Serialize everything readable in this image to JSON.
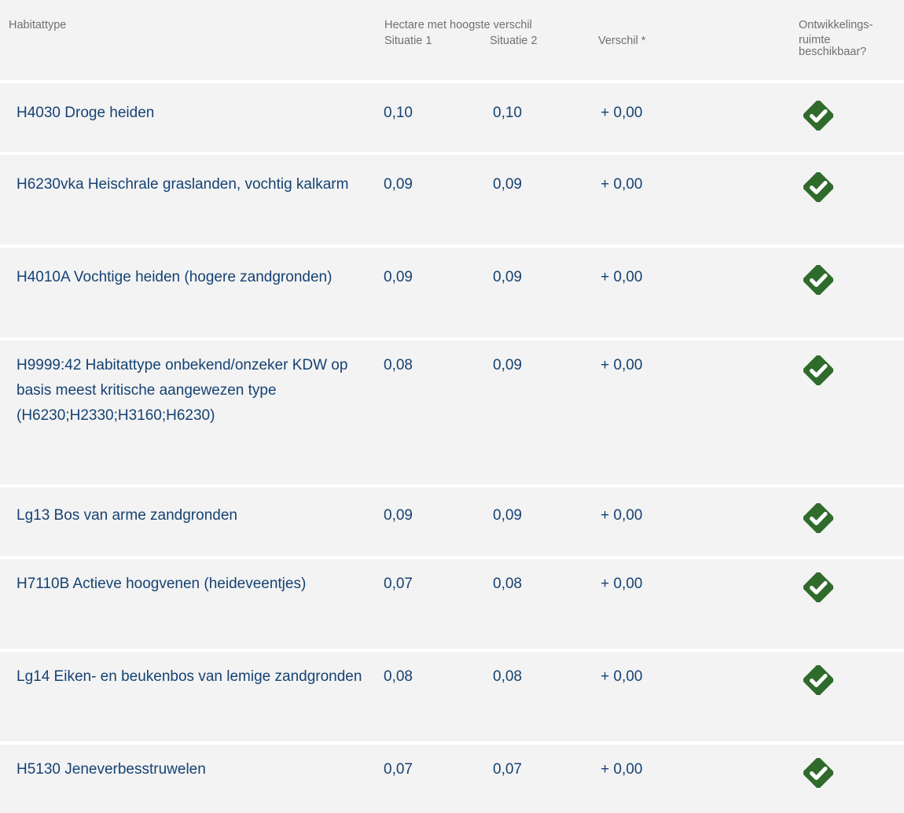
{
  "header": {
    "habitat_label": "Habitattype",
    "hectare_label": "Hectare met hoogste verschil",
    "situatie1_label": "Situatie 1",
    "situatie2_label": "Situatie 2",
    "verschil_label": "Verschil *",
    "ontwikkel_line1": "Ontwikkelings-",
    "ontwikkel_line2": "ruimte",
    "ontwikkel_line3": "beschikbaar?"
  },
  "rows": [
    {
      "name": "H4030 Droge heiden",
      "situatie1": "0,10",
      "situatie2": "0,10",
      "verschil": "+ 0,00",
      "available": true
    },
    {
      "name": "H6230vka Heischrale graslanden, vochtig kalkarm",
      "situatie1": "0,09",
      "situatie2": "0,09",
      "verschil": "+ 0,00",
      "available": true
    },
    {
      "name": "H4010A Vochtige heiden (hogere zandgronden)",
      "situatie1": "0,09",
      "situatie2": "0,09",
      "verschil": "+ 0,00",
      "available": true
    },
    {
      "name": "H9999:42 Habitattype onbekend/onzeker KDW op basis meest kritische aangewezen type (H6230;H2330;H3160;H6230)",
      "situatie1": "0,08",
      "situatie2": "0,09",
      "verschil": "+ 0,00",
      "available": true
    },
    {
      "name": "Lg13 Bos van arme zandgronden",
      "situatie1": "0,09",
      "situatie2": "0,09",
      "verschil": "+ 0,00",
      "available": true
    },
    {
      "name": "H7110B Actieve hoogvenen (heideveentjes)",
      "situatie1": "0,07",
      "situatie2": "0,08",
      "verschil": "+ 0,00",
      "available": true
    },
    {
      "name": "Lg14 Eiken- en beukenbos van lemige zandgronden",
      "situatie1": "0,08",
      "situatie2": "0,08",
      "verschil": "+ 0,00",
      "available": true
    },
    {
      "name": "H5130 Jeneverbesstruwelen",
      "situatie1": "0,07",
      "situatie2": "0,07",
      "verschil": "+ 0,00",
      "available": true
    }
  ],
  "colors": {
    "row_background": "#f3f3f3",
    "text_primary": "#154273",
    "text_header": "#707070",
    "check_green": "#2f6b2b"
  },
  "icons": {
    "available": "check-circle-icon"
  }
}
